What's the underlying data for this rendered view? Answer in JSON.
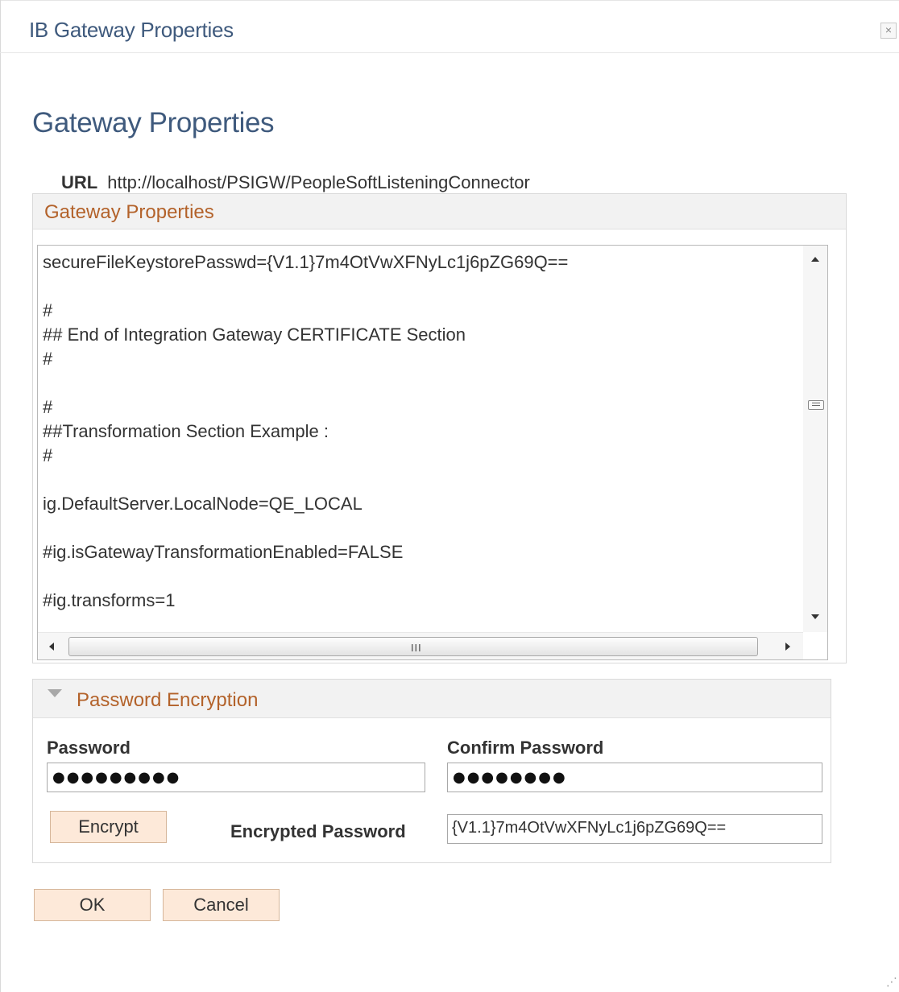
{
  "dialog": {
    "title": "IB Gateway Properties",
    "close_glyph": "×"
  },
  "page": {
    "title": "Gateway Properties",
    "url_label": "URL",
    "url_value": "http://localhost/PSIGW/PeopleSoftListeningConnector"
  },
  "gateway_properties": {
    "section_title": "Gateway Properties",
    "lines": [
      "secureFileKeystorePasswd={V1.1}7m4OtVwXFNyLc1j6pZG69Q==",
      "",
      "#",
      "## End of Integration Gateway CERTIFICATE Section",
      "#",
      "",
      "#",
      "##Transformation Section Example :",
      "#",
      "",
      "ig.DefaultServer.LocalNode=QE_LOCAL",
      "",
      "#ig.isGatewayTransformationEnabled=FALSE",
      "",
      "#ig.transforms=1"
    ],
    "hscroll_grip": "III"
  },
  "password_encryption": {
    "section_title": "Password Encryption",
    "password_label": "Password",
    "password_value": "●●●●●●●●●",
    "confirm_label": "Confirm Password",
    "confirm_value": "●●●●●●●●",
    "encrypt_label": "Encrypt",
    "encrypted_label": "Encrypted Password",
    "encrypted_value": "{V1.1}7m4OtVwXFNyLc1j6pZG69Q=="
  },
  "footer": {
    "ok_label": "OK",
    "cancel_label": "Cancel"
  },
  "colors": {
    "title_blue": "#3f5a7d",
    "section_orange": "#b3622a",
    "button_fill": "#fde9d9",
    "header_gray": "#f2f2f2"
  },
  "icons": {
    "close": "close-icon",
    "collapse": "triangle-down-icon",
    "resize": "resize-grip-icon"
  }
}
